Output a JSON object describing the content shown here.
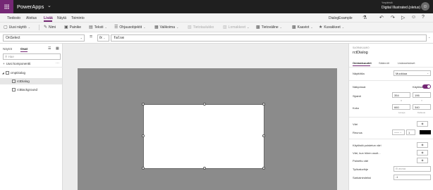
{
  "app": {
    "name": "PowerApps"
  },
  "environment": {
    "label": "Ympäristö",
    "name": "Digital Illustrated (oletus)",
    "avatar_initial": ""
  },
  "menu": {
    "items": [
      "Tiedosto",
      "Aloitus",
      "Lisää",
      "Näytä",
      "Toiminto"
    ],
    "active": "Lisää",
    "doc_name": "DialogExample"
  },
  "ribbon": {
    "items": [
      {
        "label": "Uusi näyttö",
        "icon": "new-screen-icon",
        "chevron": true,
        "disabled": false
      },
      {
        "label": "Nimi",
        "icon": "label-icon",
        "chevron": false,
        "disabled": false
      },
      {
        "label": "Painike",
        "icon": "button-icon",
        "chevron": false,
        "disabled": false
      },
      {
        "label": "Teksti",
        "icon": "text-icon",
        "chevron": true,
        "disabled": false
      },
      {
        "label": "Ohjausobjektit",
        "icon": "controls-icon",
        "chevron": true,
        "disabled": false
      },
      {
        "label": "Valikoima",
        "icon": "gallery-icon",
        "chevron": true,
        "disabled": false
      },
      {
        "label": "Tietotaulukko",
        "icon": "data-table-icon",
        "chevron": false,
        "disabled": true
      },
      {
        "label": "Lomakkeet",
        "icon": "forms-icon",
        "chevron": true,
        "disabled": true
      },
      {
        "label": "Tietoväline",
        "icon": "media-icon",
        "chevron": true,
        "disabled": false
      },
      {
        "label": "Kaaviot",
        "icon": "charts-icon",
        "chevron": true,
        "disabled": false
      },
      {
        "label": "Kuvakkeet",
        "icon": "icons-icon",
        "chevron": true,
        "disabled": false
      }
    ]
  },
  "formula": {
    "property": "OnSelect",
    "equals": "=",
    "fx": "fx",
    "value": "false"
  },
  "left_panel": {
    "tabs": [
      "Näytöt",
      "Osat"
    ],
    "active_tab": "Osat",
    "search_placeholder": "Hae",
    "add_component": "Uusi komponentti",
    "tree": [
      {
        "label": "cmpDialog",
        "level": 0,
        "selected": false
      },
      {
        "label": "rctDialog",
        "level": 1,
        "selected": true
      },
      {
        "label": "rctBackground",
        "level": 1,
        "selected": false
      }
    ]
  },
  "right_panel": {
    "type_label": "SUORAKULMIO",
    "name": "rctDialog",
    "tabs": [
      "Ominaisuudet",
      "Säännöt",
      "Lisäasetukset"
    ],
    "active_tab": "Ominaisuudet",
    "display_mode_label": "Näyttötila",
    "display_mode_value": "Muokkaa",
    "visible_label": "Näkyvissä",
    "visible_state": "Käytössä",
    "visible_on": true,
    "position_label": "Sijainti",
    "position_x": "354",
    "position_y": "196",
    "position_x_label": "X",
    "position_y_label": "Y",
    "size_label": "Koko",
    "size_w": "660",
    "size_h": "340",
    "size_w_label": "Leveys",
    "size_h_label": "Korkeus",
    "color_label": "Väri",
    "border_label": "Reunus",
    "border_width": "1",
    "border_color": "#000000",
    "disabled_color_label": "Käytöstä poistetun väri",
    "hover_color_label": "Väri, kun hiiren osoit...",
    "pressed_color_label": "Painettu väri",
    "tooltip_label": "Työkaluvihje",
    "tooltip_placeholder": "Ei arvoa",
    "tabindex_label": "Sarkainindeksi",
    "tabindex_value": "-1",
    "fill_color": "#ffffff",
    "accent": "#742774"
  },
  "canvas": {
    "screen_color": "#8b8b8b",
    "dialog_fill": "#ffffff"
  }
}
